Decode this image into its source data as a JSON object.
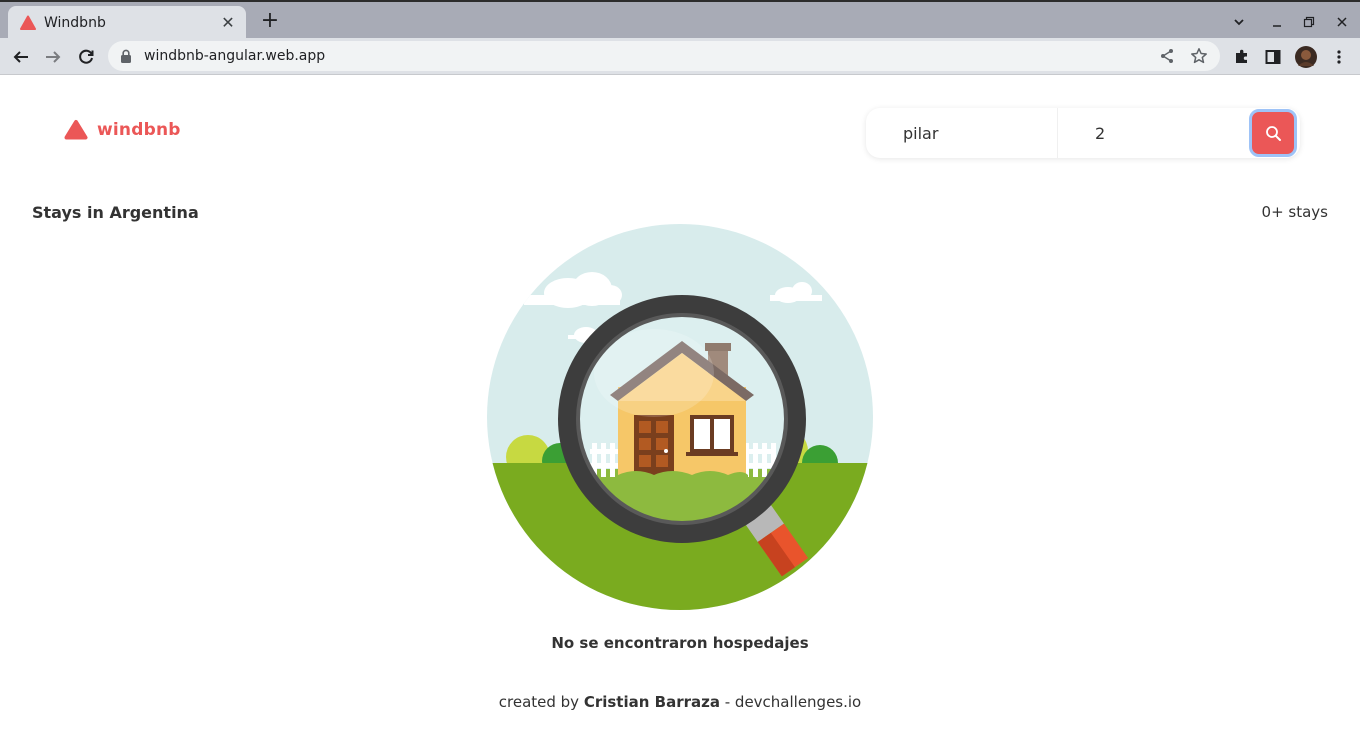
{
  "browser": {
    "tab_title": "Windbnb",
    "tab_close": "✕",
    "new_tab": "+",
    "url": "windbnb-angular.web.app"
  },
  "app": {
    "logo_text": "windbnb",
    "brand_color": "#eb5757",
    "search": {
      "location_value": "pilar",
      "guests_value": "2"
    },
    "stays_title": "Stays in Argentina",
    "stays_count": "0+ stays",
    "empty_message": "No se encontraron hospedajes",
    "footer": {
      "prefix": "created by ",
      "author": "Cristian Barraza",
      "suffix": " - devchallenges.io"
    }
  },
  "icons": {
    "favicon": "airbnb-triangle-icon",
    "back": "arrow-left-icon",
    "forward": "arrow-right-icon",
    "reload": "reload-icon",
    "lock": "lock-icon",
    "share": "share-icon",
    "bookmark": "star-icon",
    "extensions": "puzzle-icon",
    "sidepanel": "side-panel-icon",
    "profile": "avatar",
    "menu": "kebab-menu-icon",
    "search": "search-icon"
  }
}
